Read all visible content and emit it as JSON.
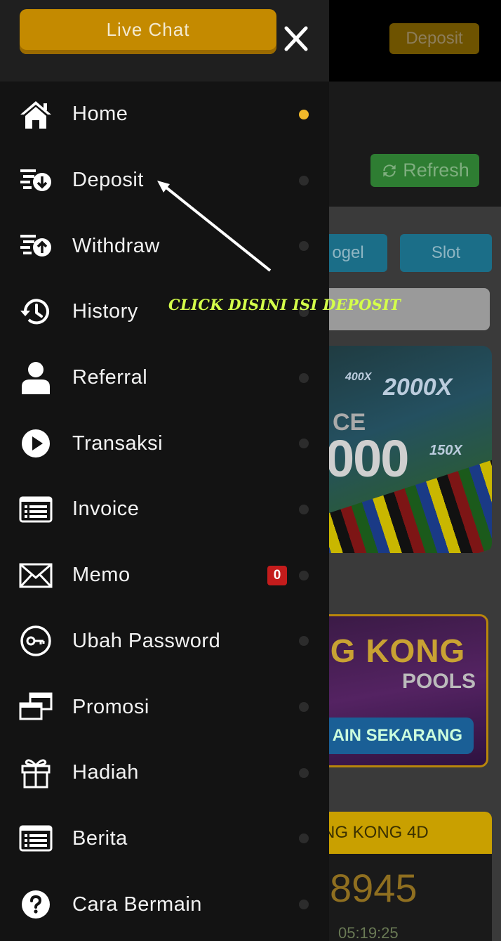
{
  "background": {
    "deposit_button": "Deposit",
    "refresh_button": "Refresh",
    "tabs": [
      "ogel",
      "Slot"
    ],
    "banner1": {
      "ce": "CE",
      "big": "000",
      "multipliers": [
        "400X",
        "2000X",
        "150X"
      ]
    },
    "banner2": {
      "title": "IG KONG",
      "subtitle": "POOLS",
      "cta": "AIN SEKARANG"
    },
    "result": {
      "title": "NG KONG 4D",
      "number": "8945",
      "time": "05:19:25"
    }
  },
  "drawer": {
    "live_chat_label": "Live Chat",
    "close_icon": "close-icon",
    "menu": [
      {
        "label": "Home",
        "icon": "home-icon",
        "active": true
      },
      {
        "label": "Deposit",
        "icon": "deposit-icon",
        "active": false
      },
      {
        "label": "Withdraw",
        "icon": "withdraw-icon",
        "active": false
      },
      {
        "label": "History",
        "icon": "history-icon",
        "active": false
      },
      {
        "label": "Referral",
        "icon": "user-icon",
        "active": false
      },
      {
        "label": "Transaksi",
        "icon": "play-icon",
        "active": false
      },
      {
        "label": "Invoice",
        "icon": "list-icon",
        "active": false
      },
      {
        "label": "Memo",
        "icon": "envelope-icon",
        "active": false,
        "badge": "0"
      },
      {
        "label": "Ubah Password",
        "icon": "key-icon",
        "active": false
      },
      {
        "label": "Promosi",
        "icon": "windows-icon",
        "active": false
      },
      {
        "label": "Hadiah",
        "icon": "gift-icon",
        "active": false
      },
      {
        "label": "Berita",
        "icon": "news-icon",
        "active": false
      },
      {
        "label": "Cara Bermain",
        "icon": "question-icon",
        "active": false
      }
    ]
  },
  "annotation": {
    "text": "CLICK DISINI ISI DEPOSIT"
  },
  "colors": {
    "accent_gold": "#c48a00",
    "active_dot": "#f0b82a",
    "badge_red": "#c41c1c",
    "annotation_text": "#d4ff4a",
    "drawer_bg": "#131313"
  }
}
